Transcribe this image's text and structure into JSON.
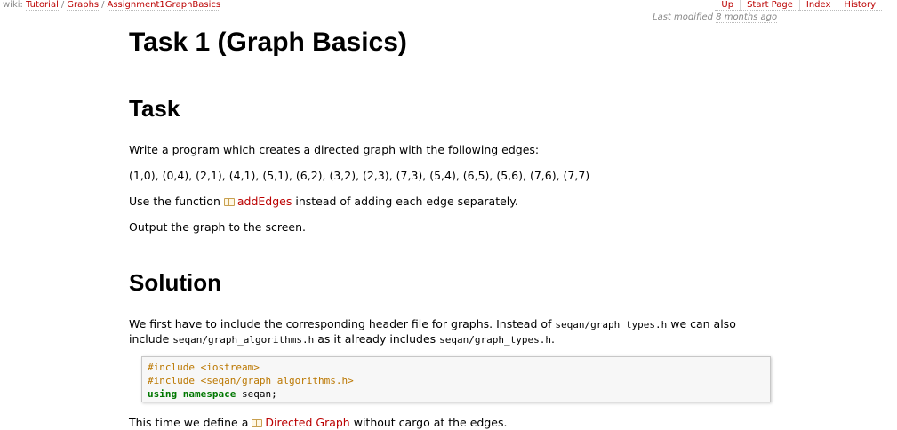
{
  "topbar": {
    "wiki_prefix": "wiki:",
    "breadcrumbs": [
      "Tutorial",
      "Graphs",
      "Assignment1GraphBasics"
    ],
    "separator": "/",
    "nav": [
      "Up",
      "Start Page",
      "Index",
      "History"
    ]
  },
  "lastmod": {
    "label": "Last modified",
    "age": "8 months ago"
  },
  "page": {
    "title": "Task 1 (Graph Basics)",
    "task_heading": "Task",
    "task_p1": "Write a program which creates a directed graph with the following edges:",
    "edges": "(1,0), (0,4), (2,1), (4,1), (5,1), (6,2), (3,2), (2,3), (7,3), (5,4), (6,5), (5,6), (7,6), (7,7)",
    "use_fn_prefix": "Use the function",
    "use_fn_link": "addEdges",
    "use_fn_suffix": "instead of adding each edge separately.",
    "output_text": "Output the graph to the screen.",
    "solution_heading": "Solution",
    "sol_p1": "We first have to include the corresponding header file for graphs. Instead of",
    "sol_code1": "seqan/graph_types.h",
    "sol_p2": "we can also include",
    "sol_code2": "seqan/graph_algorithms.h",
    "sol_p3": "as it already includes",
    "sol_code3": "seqan/graph_types.h",
    "sol_p4": ".",
    "code_lines": {
      "line1": "#include <iostream>",
      "line2": "#include <seqan/graph_algorithms.h>",
      "kw_using": "using",
      "kw_namespace": "namespace",
      "ns": "seqan;"
    },
    "bottom_prefix": "This time we define a",
    "bottom_link": "Directed Graph",
    "bottom_suffix": "without cargo at the edges."
  },
  "colors": {
    "link": "#bb0000",
    "preproc": "#bb7700",
    "keyword": "#007700",
    "meta": "#888888"
  }
}
